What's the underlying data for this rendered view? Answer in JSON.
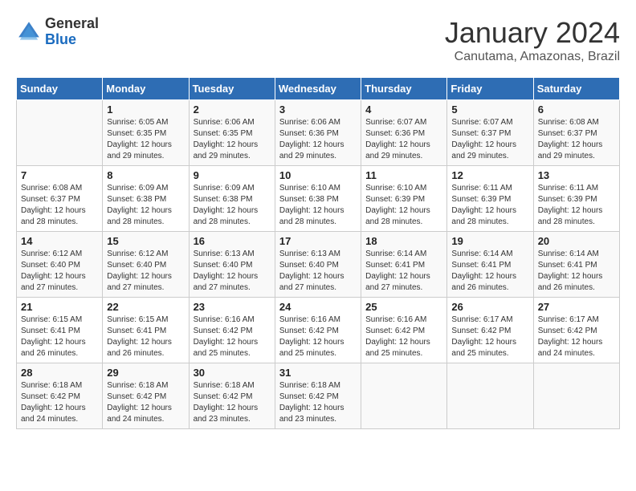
{
  "header": {
    "logo_general": "General",
    "logo_blue": "Blue",
    "month": "January 2024",
    "location": "Canutama, Amazonas, Brazil"
  },
  "days_of_week": [
    "Sunday",
    "Monday",
    "Tuesday",
    "Wednesday",
    "Thursday",
    "Friday",
    "Saturday"
  ],
  "weeks": [
    [
      {
        "day": "",
        "info": ""
      },
      {
        "day": "1",
        "info": "Sunrise: 6:05 AM\nSunset: 6:35 PM\nDaylight: 12 hours\nand 29 minutes."
      },
      {
        "day": "2",
        "info": "Sunrise: 6:06 AM\nSunset: 6:35 PM\nDaylight: 12 hours\nand 29 minutes."
      },
      {
        "day": "3",
        "info": "Sunrise: 6:06 AM\nSunset: 6:36 PM\nDaylight: 12 hours\nand 29 minutes."
      },
      {
        "day": "4",
        "info": "Sunrise: 6:07 AM\nSunset: 6:36 PM\nDaylight: 12 hours\nand 29 minutes."
      },
      {
        "day": "5",
        "info": "Sunrise: 6:07 AM\nSunset: 6:37 PM\nDaylight: 12 hours\nand 29 minutes."
      },
      {
        "day": "6",
        "info": "Sunrise: 6:08 AM\nSunset: 6:37 PM\nDaylight: 12 hours\nand 29 minutes."
      }
    ],
    [
      {
        "day": "7",
        "info": "Sunrise: 6:08 AM\nSunset: 6:37 PM\nDaylight: 12 hours\nand 28 minutes."
      },
      {
        "day": "8",
        "info": "Sunrise: 6:09 AM\nSunset: 6:38 PM\nDaylight: 12 hours\nand 28 minutes."
      },
      {
        "day": "9",
        "info": "Sunrise: 6:09 AM\nSunset: 6:38 PM\nDaylight: 12 hours\nand 28 minutes."
      },
      {
        "day": "10",
        "info": "Sunrise: 6:10 AM\nSunset: 6:38 PM\nDaylight: 12 hours\nand 28 minutes."
      },
      {
        "day": "11",
        "info": "Sunrise: 6:10 AM\nSunset: 6:39 PM\nDaylight: 12 hours\nand 28 minutes."
      },
      {
        "day": "12",
        "info": "Sunrise: 6:11 AM\nSunset: 6:39 PM\nDaylight: 12 hours\nand 28 minutes."
      },
      {
        "day": "13",
        "info": "Sunrise: 6:11 AM\nSunset: 6:39 PM\nDaylight: 12 hours\nand 28 minutes."
      }
    ],
    [
      {
        "day": "14",
        "info": "Sunrise: 6:12 AM\nSunset: 6:40 PM\nDaylight: 12 hours\nand 27 minutes."
      },
      {
        "day": "15",
        "info": "Sunrise: 6:12 AM\nSunset: 6:40 PM\nDaylight: 12 hours\nand 27 minutes."
      },
      {
        "day": "16",
        "info": "Sunrise: 6:13 AM\nSunset: 6:40 PM\nDaylight: 12 hours\nand 27 minutes."
      },
      {
        "day": "17",
        "info": "Sunrise: 6:13 AM\nSunset: 6:40 PM\nDaylight: 12 hours\nand 27 minutes."
      },
      {
        "day": "18",
        "info": "Sunrise: 6:14 AM\nSunset: 6:41 PM\nDaylight: 12 hours\nand 27 minutes."
      },
      {
        "day": "19",
        "info": "Sunrise: 6:14 AM\nSunset: 6:41 PM\nDaylight: 12 hours\nand 26 minutes."
      },
      {
        "day": "20",
        "info": "Sunrise: 6:14 AM\nSunset: 6:41 PM\nDaylight: 12 hours\nand 26 minutes."
      }
    ],
    [
      {
        "day": "21",
        "info": "Sunrise: 6:15 AM\nSunset: 6:41 PM\nDaylight: 12 hours\nand 26 minutes."
      },
      {
        "day": "22",
        "info": "Sunrise: 6:15 AM\nSunset: 6:41 PM\nDaylight: 12 hours\nand 26 minutes."
      },
      {
        "day": "23",
        "info": "Sunrise: 6:16 AM\nSunset: 6:42 PM\nDaylight: 12 hours\nand 25 minutes."
      },
      {
        "day": "24",
        "info": "Sunrise: 6:16 AM\nSunset: 6:42 PM\nDaylight: 12 hours\nand 25 minutes."
      },
      {
        "day": "25",
        "info": "Sunrise: 6:16 AM\nSunset: 6:42 PM\nDaylight: 12 hours\nand 25 minutes."
      },
      {
        "day": "26",
        "info": "Sunrise: 6:17 AM\nSunset: 6:42 PM\nDaylight: 12 hours\nand 25 minutes."
      },
      {
        "day": "27",
        "info": "Sunrise: 6:17 AM\nSunset: 6:42 PM\nDaylight: 12 hours\nand 24 minutes."
      }
    ],
    [
      {
        "day": "28",
        "info": "Sunrise: 6:18 AM\nSunset: 6:42 PM\nDaylight: 12 hours\nand 24 minutes."
      },
      {
        "day": "29",
        "info": "Sunrise: 6:18 AM\nSunset: 6:42 PM\nDaylight: 12 hours\nand 24 minutes."
      },
      {
        "day": "30",
        "info": "Sunrise: 6:18 AM\nSunset: 6:42 PM\nDaylight: 12 hours\nand 23 minutes."
      },
      {
        "day": "31",
        "info": "Sunrise: 6:18 AM\nSunset: 6:42 PM\nDaylight: 12 hours\nand 23 minutes."
      },
      {
        "day": "",
        "info": ""
      },
      {
        "day": "",
        "info": ""
      },
      {
        "day": "",
        "info": ""
      }
    ]
  ]
}
